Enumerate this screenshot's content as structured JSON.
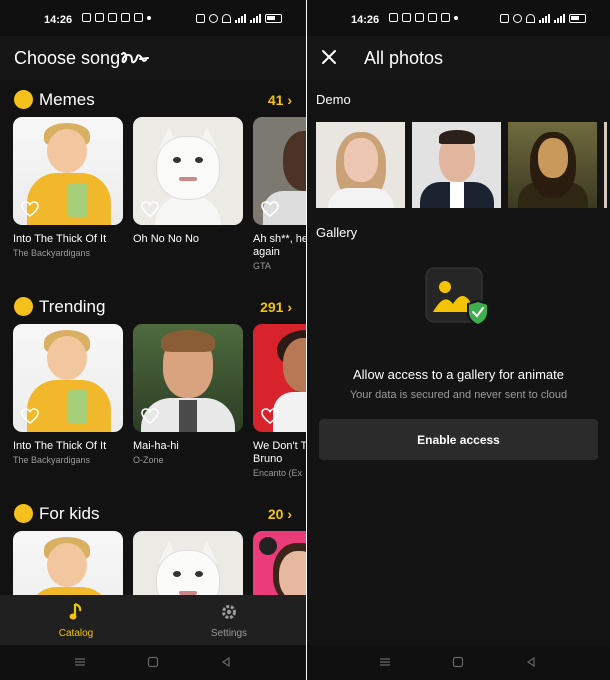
{
  "status_bar": {
    "time": "14:26"
  },
  "catalog": {
    "header_title": "Choose song",
    "sections": [
      {
        "title": "Memes",
        "count": "41",
        "cards": [
          {
            "title": "Into The Thick Of It",
            "subtitle": "The Backyardigans"
          },
          {
            "title": "Oh No No No",
            "subtitle": ""
          },
          {
            "title": "Ah sh**, he",
            "title_line2": "again",
            "subtitle": "GTA"
          }
        ]
      },
      {
        "title": "Trending",
        "count": "291",
        "cards": [
          {
            "title": "Into The Thick Of It",
            "subtitle": "The Backyardigans"
          },
          {
            "title": "Mai-ha-hi",
            "subtitle": "O-Zone"
          },
          {
            "title": "We Don't T",
            "title_line2": "Bruno",
            "subtitle": "Encanto (Ex"
          }
        ]
      },
      {
        "title": "For kids",
        "count": "20",
        "cards": []
      }
    ],
    "nav": {
      "catalog": "Catalog",
      "settings": "Settings"
    }
  },
  "photos": {
    "header_title": "All photos",
    "demo_label": "Demo",
    "gallery_label": "Gallery",
    "allow_title": "Allow access to a gallery for animate",
    "allow_subtitle": "Your data is secured and never sent to cloud",
    "enable_button": "Enable access"
  },
  "colors": {
    "accent": "#f5c400",
    "background": "#161616",
    "button": "#2b2b2b"
  }
}
